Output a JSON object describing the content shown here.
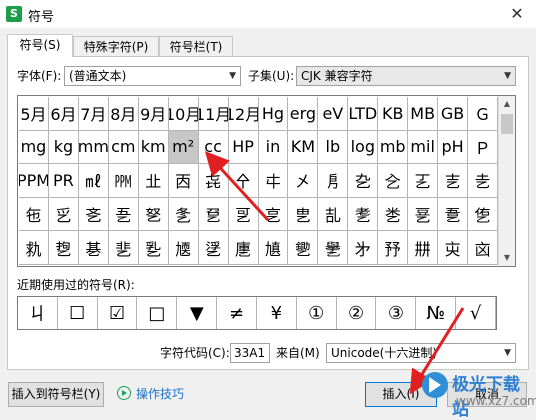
{
  "window": {
    "title": "符号",
    "app_icon": "S"
  },
  "tabs": [
    {
      "label": "符号(S)",
      "active": true
    },
    {
      "label": "特殊字符(P)",
      "active": false
    },
    {
      "label": "符号栏(T)",
      "active": false
    }
  ],
  "font": {
    "label": "字体(F):",
    "value": "(普通文本)"
  },
  "subset": {
    "label": "子集(U):",
    "value": "CJK 兼容字符"
  },
  "symbol_grid": {
    "rows": [
      [
        "5月",
        "6月",
        "7月",
        "8月",
        "9月",
        "10月",
        "11月",
        "12月",
        "Hg",
        "erg",
        "eV",
        "LTD",
        "KB",
        "MB",
        "GB",
        "Ｇ"
      ],
      [
        "mg",
        "kg",
        "mm",
        "cm",
        "km",
        "m²",
        "cc",
        "HP",
        "in",
        "KM",
        "lb",
        "log",
        "mb",
        "mil",
        "pH",
        "Ｐ"
      ],
      [
        "PPM",
        "PR",
        "㎖",
        "㏙",
        "㐀",
        "㐁",
        "㐂",
        "㐃",
        "㐄",
        "㐅",
        "㐆",
        "㐇",
        "㐈",
        "㐉",
        "㐊",
        "㐋"
      ],
      [
        "㐌",
        "㐍",
        "㐎",
        "㐏",
        "㐐",
        "㐑",
        "㐒",
        "㐓",
        "㐔",
        "㐕",
        "㐖",
        "㐗",
        "㐘",
        "㐙",
        "㐚",
        "㐛"
      ],
      [
        "㐜",
        "㐝",
        "㐞",
        "㐟",
        "㐠",
        "㐡",
        "㐢",
        "㐣",
        "㐤",
        "㐥",
        "㐦",
        "㐧",
        "㐨",
        "㐩",
        "㐪",
        "㐫"
      ]
    ],
    "selected": "m²"
  },
  "recent": {
    "label": "近期使用过的符号(R):",
    "symbols": [
      "ㄐ",
      "☐",
      "☑",
      "□",
      "▼",
      "≠",
      "¥",
      "①",
      "②",
      "③",
      "№",
      "√",
      "×",
      "↓",
      "→"
    ]
  },
  "char_code": {
    "label": "字符代码(C):",
    "value": "33A1"
  },
  "from": {
    "label": "来自(M)",
    "value": "Unicode(十六进制)"
  },
  "buttons": {
    "insert_to_bar": "插入到符号栏(Y)",
    "help": "操作技巧",
    "insert": "插入(I)",
    "cancel": "取消"
  },
  "watermark": {
    "brand": "极光下载站",
    "url": "www.xz7.com"
  }
}
